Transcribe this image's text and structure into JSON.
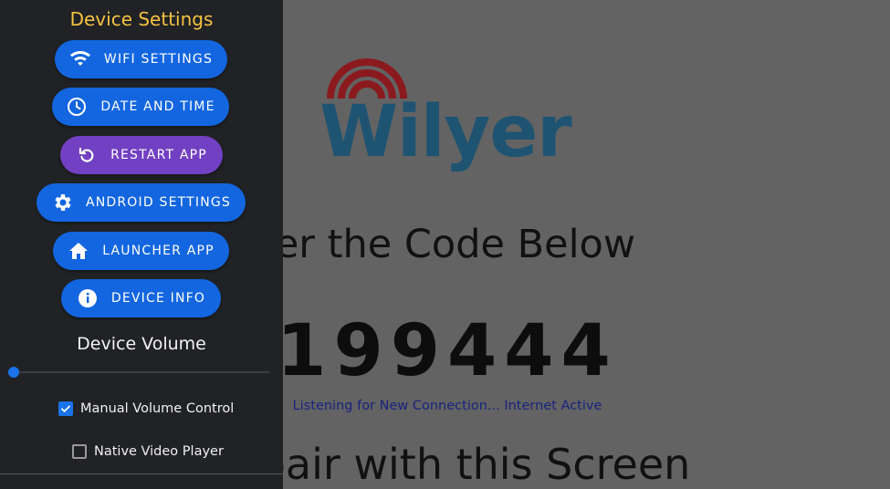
{
  "drawer": {
    "title": "Device Settings",
    "buttons": [
      {
        "label": "WIFI SETTINGS",
        "icon": "wifi-icon"
      },
      {
        "label": "DATE AND TIME",
        "icon": "clock-icon"
      },
      {
        "label": "RESTART APP",
        "icon": "restart-icon"
      },
      {
        "label": "ANDROID SETTINGS",
        "icon": "gear-icon"
      },
      {
        "label": "LAUNCHER APP",
        "icon": "home-icon"
      },
      {
        "label": "DEVICE INFO",
        "icon": "info-icon"
      }
    ],
    "volume": {
      "title": "Device Volume",
      "level": 0
    },
    "checkboxes": [
      {
        "label": "Manual Volume Control",
        "checked": true
      },
      {
        "label": "Native Video Player",
        "checked": false
      }
    ]
  },
  "main": {
    "logo_text": "Wilyer",
    "instruction": "ter the Code Below",
    "code": "199444",
    "status": "Listening for New Connection... Internet Active",
    "pair_text": "pair with this Screen"
  },
  "colors": {
    "drawer_bg": "#202225",
    "title": "#f5c242",
    "button_blue": "#1366e0",
    "button_purple": "#7240c2",
    "logo_red": "#8b1a1f",
    "logo_blue": "#1e5472",
    "status_text": "#1a237e"
  }
}
